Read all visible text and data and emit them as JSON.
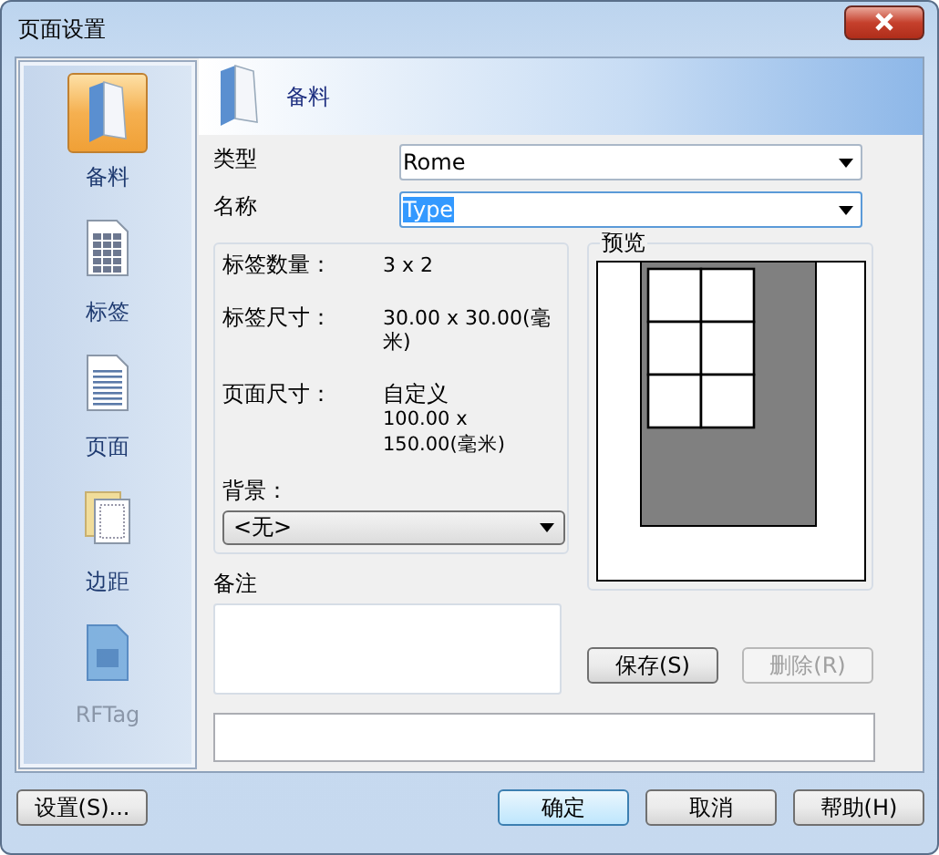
{
  "window": {
    "title": "页面设置"
  },
  "sidebar": {
    "items": [
      {
        "label": "备料",
        "kind": "folder",
        "selected": true,
        "disabled": false
      },
      {
        "label": "标签",
        "kind": "grid",
        "selected": false,
        "disabled": false
      },
      {
        "label": "页面",
        "kind": "page",
        "selected": false,
        "disabled": false
      },
      {
        "label": "边距",
        "kind": "margin",
        "selected": false,
        "disabled": false
      },
      {
        "label": "RFTag",
        "kind": "tag",
        "selected": false,
        "disabled": true
      }
    ]
  },
  "header": {
    "title": "备料"
  },
  "fields": [
    {
      "label": "类型",
      "value": "Rome",
      "text_selected": false
    },
    {
      "label": "名称",
      "value": "Type",
      "text_selected": true
    }
  ],
  "info": [
    {
      "label": "标签数量：",
      "value": "3 x 2"
    },
    {
      "label": "标签尺寸：",
      "value": "30.00 x 30.00(毫米)"
    },
    {
      "label": "页面尺寸：",
      "value": "自定义",
      "detail": "100.00 x 150.00(毫米)"
    }
  ],
  "background": {
    "label": "背景：",
    "value": "<无>"
  },
  "notes": {
    "label": "备注"
  },
  "preview": {
    "label": "预览"
  },
  "preview_buttons": [
    {
      "label": "保存(S)",
      "disabled": false
    },
    {
      "label": "删除(R)",
      "disabled": true
    }
  ],
  "footer_buttons": [
    {
      "label": "设置(S)...",
      "default": false
    },
    {
      "label": "确定",
      "default": true
    },
    {
      "label": "取消",
      "default": false
    },
    {
      "label": "帮助(H)",
      "default": false
    }
  ]
}
